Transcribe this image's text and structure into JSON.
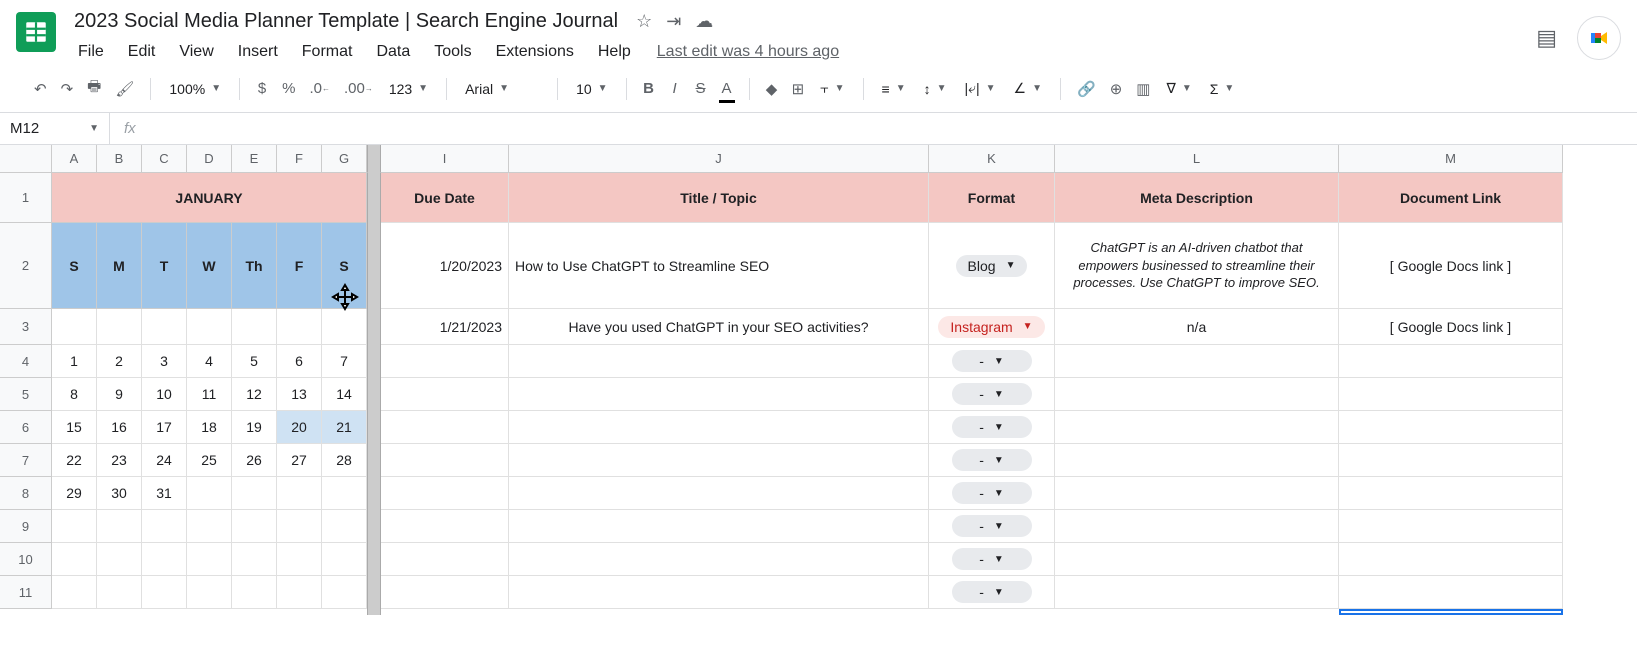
{
  "doc_title": "2023 Social Media Planner Template | Search Engine Journal",
  "menu": {
    "file": "File",
    "edit": "Edit",
    "view": "View",
    "insert": "Insert",
    "format": "Format",
    "data": "Data",
    "tools": "Tools",
    "extensions": "Extensions",
    "help": "Help"
  },
  "last_edit": "Last edit was 4 hours ago",
  "toolbar": {
    "zoom": "100%",
    "currency": "$",
    "percent": "%",
    "dec_dec": ".0",
    "inc_dec": ".00",
    "more_fmt": "123",
    "font": "Arial",
    "size": "10"
  },
  "name_box": "M12",
  "fx_label": "fx",
  "columns": {
    "A": "A",
    "B": "B",
    "C": "C",
    "D": "D",
    "E": "E",
    "F": "F",
    "G": "G",
    "I": "I",
    "J": "J",
    "K": "K",
    "L": "L",
    "M": "M"
  },
  "row_nums": [
    "1",
    "2",
    "3",
    "4",
    "5",
    "6",
    "7",
    "8",
    "9",
    "10",
    "11"
  ],
  "headers": {
    "january": "JANUARY",
    "due": "Due Date",
    "title": "Title / Topic",
    "format": "Format",
    "meta": "Meta Description",
    "link": "Document Link"
  },
  "days": {
    "s1": "S",
    "m": "M",
    "t": "T",
    "w": "W",
    "th": "Th",
    "f": "F",
    "s2": "S"
  },
  "row2": {
    "due": "1/20/2023",
    "title": "How to Use ChatGPT to Streamline SEO",
    "format": "Blog",
    "meta": "ChatGPT is an AI-driven chatbot that empowers businessed to streamline their processes. Use ChatGPT to improve SEO.",
    "link": "[ Google Docs link ]"
  },
  "row3": {
    "due": "1/21/2023",
    "title": "Have you used ChatGPT in your SEO activities?",
    "format": "Instagram",
    "meta": "n/a",
    "link": "[ Google Docs link ]"
  },
  "chip_dash": "-",
  "calendar": [
    [
      "1",
      "2",
      "3",
      "4",
      "5",
      "6",
      "7"
    ],
    [
      "8",
      "9",
      "10",
      "11",
      "12",
      "13",
      "14"
    ],
    [
      "15",
      "16",
      "17",
      "18",
      "19",
      "20",
      "21"
    ],
    [
      "22",
      "23",
      "24",
      "25",
      "26",
      "27",
      "28"
    ],
    [
      "29",
      "30",
      "31",
      "",
      "",
      "",
      ""
    ]
  ]
}
